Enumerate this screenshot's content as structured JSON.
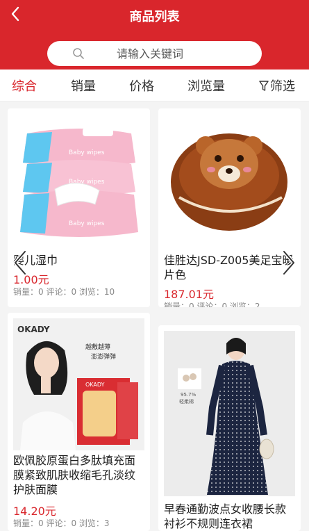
{
  "header": {
    "title": "商品列表",
    "search_placeholder": "请输入关键词",
    "brand_color": "#d9262c"
  },
  "sort_tabs": [
    {
      "label": "综合",
      "active": true
    },
    {
      "label": "销量"
    },
    {
      "label": "价格"
    },
    {
      "label": "浏览量"
    },
    {
      "label": "筛选",
      "icon": "filter-icon"
    }
  ],
  "products": [
    {
      "name": "婴儿湿巾",
      "price": "1.00元",
      "meta": "销量：0 评论：0 浏览：10",
      "image": "baby-wipes-image",
      "image_text": "Baby wipes"
    },
    {
      "name": "佳胜达JSD-Z005美足宝暖片色",
      "price": "187.01元",
      "meta": "销量：0 评论：0 浏览：2",
      "image": "bear-foot-warmer-image"
    },
    {
      "name": "欧佩胶原蛋白多肽填充面膜紧致肌肤收缩毛孔淡纹护肤面膜",
      "price": "14.20元",
      "meta": "销量：0 评论：0 浏览：3",
      "image": "okady-face-mask-image",
      "brand_text": "OKADY",
      "promo_text": "越敷越薄 澎澎弹弹"
    },
    {
      "name": "早春通勤波点女收腰长款衬衫不规则连衣裙",
      "image": "polka-dot-dress-image",
      "badge_text": "95.7% 轻柔棉"
    }
  ]
}
